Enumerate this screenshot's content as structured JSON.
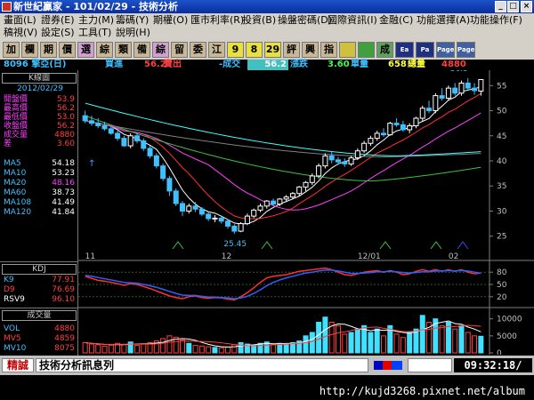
{
  "window": {
    "title": "新世紀贏家 - 101/02/29 - 技術分析"
  },
  "menu": {
    "row1": [
      "畫面(L)",
      "證券(E)",
      "主力(M)",
      "籌碼(Y)",
      "期權(O)",
      "匯市利率(R)",
      "投資(B)",
      "操盤密碼(D)",
      "國際資訊(I)",
      "金融(C)",
      "功能選擇(A)",
      "功能操作(F)"
    ],
    "row2": [
      "稿視(V)",
      "設定(S)",
      "工具(T)",
      "說明(H)"
    ]
  },
  "toolbar": {
    "buttons": [
      "加",
      "欄",
      "期",
      "價",
      "選",
      "綜",
      "類",
      "備",
      "綜",
      "留",
      "委",
      "江",
      "9",
      "8",
      "29",
      "評",
      "興",
      "指",
      "",
      "",
      "成",
      "Ea",
      "Pa",
      "Page",
      "Page"
    ]
  },
  "quote": {
    "symbol": "8096 擎亞(日)",
    "buy_label": "買進",
    "buy_value": "56.2",
    "sell_label": "賣出",
    "change_label": "-成交",
    "trade_value": "56.2",
    "rise_label": "漲跌",
    "change_value": "3.60",
    "volume_label": "單量",
    "total_qty": "658",
    "total_label": "總量",
    "total_value": "4880"
  },
  "info": {
    "box_title": "K線圖",
    "date": "2012/02/29",
    "rows": [
      {
        "label": "開盤價",
        "value": "53.9"
      },
      {
        "label": "最高價",
        "value": "56.2"
      },
      {
        "label": "最低價",
        "value": "53.0"
      },
      {
        "label": "收盤價",
        "value": "56.2"
      },
      {
        "label": "成交量",
        "value": "4880"
      },
      {
        "label": "差",
        "value": "3.60"
      }
    ],
    "ma": [
      {
        "label": "MA5",
        "value": "54.18"
      },
      {
        "label": "MA10",
        "value": "53.23"
      },
      {
        "label": "MA20",
        "value": "48.16"
      },
      {
        "label": "MA60",
        "value": "38.73"
      },
      {
        "label": "MA108",
        "value": "41.49"
      },
      {
        "label": "MA120",
        "value": "41.84"
      }
    ],
    "hi_marker": "56.5",
    "lo_marker": "25.45"
  },
  "kdj": {
    "title": "KDJ",
    "rows": [
      {
        "label": "K9",
        "value": "77.91"
      },
      {
        "label": "D9",
        "value": "76.69"
      },
      {
        "label": "RSV9",
        "value": "96.10"
      }
    ]
  },
  "volume": {
    "title": "成交量",
    "rows": [
      {
        "label": "VOL",
        "value": "4880"
      },
      {
        "label": "MV5",
        "value": "4859"
      },
      {
        "label": "MV10",
        "value": "8075"
      }
    ]
  },
  "status": {
    "left_label": "精誠",
    "message": "技術分析訊息列",
    "time": "09:32:18/"
  },
  "url": "http://kujd3268.pixnet.net/album",
  "colors": {
    "ma5": "#ffffff",
    "ma10": "#ff3030",
    "ma20": "#ff40ff",
    "ma60": "#40c040",
    "ma108": "#808080",
    "ma120": "#40ffff",
    "up": "#ff4040",
    "down": "#40c0ff",
    "k": "#ff3030",
    "d": "#3060ff"
  },
  "chart_data": [
    {
      "type": "candlestick",
      "title": "K線圖",
      "x_labels": [
        "11",
        "12",
        "12/01",
        "02"
      ],
      "ylim": [
        23,
        57
      ],
      "yticks": [
        25,
        30,
        35,
        40,
        45,
        50,
        55
      ],
      "price_hi": 56.5,
      "price_lo": 25.45,
      "ohlc": [
        [
          49.0,
          50.0,
          47.5,
          48.0
        ],
        [
          48.0,
          49.0,
          47.0,
          47.5
        ],
        [
          47.5,
          48.5,
          46.5,
          47.0
        ],
        [
          47.0,
          47.8,
          46.0,
          46.4
        ],
        [
          46.4,
          47.0,
          45.2,
          45.5
        ],
        [
          45.5,
          46.0,
          44.0,
          44.5
        ],
        [
          44.5,
          45.0,
          42.8,
          43.0
        ],
        [
          43.0,
          45.5,
          42.5,
          45.0
        ],
        [
          45.0,
          45.6,
          43.5,
          44.0
        ],
        [
          44.0,
          44.5,
          42.0,
          42.5
        ],
        [
          42.5,
          43.0,
          40.5,
          41.0
        ],
        [
          41.0,
          41.5,
          38.5,
          39.0
        ],
        [
          39.0,
          39.5,
          36.0,
          36.5
        ],
        [
          36.5,
          37.0,
          33.0,
          34.0
        ],
        [
          34.0,
          34.5,
          31.0,
          31.5
        ],
        [
          31.5,
          32.0,
          29.0,
          30.0
        ],
        [
          30.0,
          31.5,
          29.5,
          31.0
        ],
        [
          31.0,
          31.8,
          29.8,
          30.4
        ],
        [
          30.4,
          30.8,
          29.0,
          29.4
        ],
        [
          29.4,
          29.8,
          28.0,
          28.5
        ],
        [
          28.5,
          29.2,
          27.8,
          28.6
        ],
        [
          28.6,
          29.0,
          27.5,
          28.0
        ],
        [
          28.0,
          28.4,
          26.5,
          27.0
        ],
        [
          27.0,
          27.4,
          25.45,
          26.0
        ],
        [
          26.0,
          27.8,
          25.8,
          27.5
        ],
        [
          27.5,
          29.5,
          27.2,
          29.0
        ],
        [
          29.0,
          30.5,
          28.6,
          30.2
        ],
        [
          30.2,
          31.5,
          29.8,
          31.0
        ],
        [
          31.0,
          32.2,
          30.5,
          32.0
        ],
        [
          32.0,
          32.5,
          31.0,
          31.4
        ],
        [
          31.4,
          32.6,
          31.0,
          32.4
        ],
        [
          32.4,
          33.2,
          31.8,
          32.8
        ],
        [
          32.8,
          33.8,
          32.4,
          33.5
        ],
        [
          33.5,
          35.0,
          33.0,
          34.8
        ],
        [
          34.8,
          36.0,
          34.0,
          35.7
        ],
        [
          35.7,
          37.5,
          35.2,
          37.0
        ],
        [
          37.0,
          39.5,
          36.5,
          39.0
        ],
        [
          39.0,
          41.5,
          38.5,
          41.0
        ],
        [
          41.0,
          42.0,
          39.5,
          40.2
        ],
        [
          40.2,
          40.8,
          39.2,
          39.8
        ],
        [
          39.8,
          40.5,
          38.8,
          39.4
        ],
        [
          39.4,
          41.0,
          39.0,
          40.6
        ],
        [
          40.6,
          42.5,
          40.2,
          42.0
        ],
        [
          42.0,
          44.0,
          41.6,
          43.5
        ],
        [
          43.5,
          45.0,
          43.0,
          44.5
        ],
        [
          44.5,
          46.0,
          44.0,
          45.5
        ],
        [
          45.5,
          46.5,
          44.8,
          45.2
        ],
        [
          45.2,
          47.8,
          45.0,
          47.5
        ],
        [
          47.5,
          48.5,
          46.8,
          47.2
        ],
        [
          47.2,
          48.0,
          45.8,
          46.2
        ],
        [
          46.2,
          47.5,
          45.5,
          47.0
        ],
        [
          47.0,
          48.8,
          46.5,
          48.5
        ],
        [
          48.5,
          51.0,
          48.0,
          50.5
        ],
        [
          50.5,
          52.0,
          49.5,
          50.0
        ],
        [
          50.0,
          53.5,
          49.5,
          53.0
        ],
        [
          53.0,
          54.5,
          52.0,
          52.5
        ],
        [
          52.5,
          55.0,
          52.0,
          54.5
        ],
        [
          54.5,
          55.5,
          53.0,
          53.5
        ],
        [
          53.5,
          56.0,
          53.0,
          55.5
        ],
        [
          55.5,
          56.5,
          54.0,
          54.5
        ],
        [
          54.5,
          55.5,
          53.2,
          54.0
        ],
        [
          53.9,
          56.2,
          53.0,
          56.2
        ]
      ]
    },
    {
      "type": "line",
      "title": "KDJ",
      "ylim": [
        0,
        100
      ],
      "yticks": [
        20,
        50,
        80
      ],
      "series": [
        {
          "name": "K9",
          "values": [
            70,
            65,
            60,
            58,
            55,
            52,
            48,
            52,
            50,
            45,
            40,
            34,
            28,
            22,
            18,
            15,
            20,
            22,
            18,
            16,
            18,
            17,
            14,
            12,
            20,
            30,
            42,
            55,
            66,
            70,
            72,
            74,
            78,
            82,
            84,
            86,
            88,
            90,
            86,
            80,
            74,
            72,
            76,
            80,
            82,
            84,
            80,
            84,
            80,
            74,
            76,
            82,
            86,
            82,
            86,
            82,
            86,
            82,
            86,
            80,
            76,
            78
          ]
        },
        {
          "name": "D9",
          "values": [
            72,
            70,
            67,
            64,
            61,
            58,
            55,
            54,
            53,
            50,
            47,
            43,
            38,
            33,
            28,
            24,
            23,
            23,
            21,
            19,
            19,
            18,
            17,
            15,
            17,
            21,
            28,
            37,
            47,
            55,
            61,
            66,
            70,
            74,
            78,
            80,
            83,
            85,
            85,
            83,
            80,
            77,
            77,
            78,
            79,
            81,
            81,
            82,
            81,
            79,
            78,
            79,
            81,
            81,
            83,
            83,
            84,
            83,
            84,
            83,
            80,
            77
          ]
        }
      ]
    },
    {
      "type": "bar",
      "title": "成交量",
      "ylim": [
        0,
        12000
      ],
      "yticks": [
        0,
        5000,
        10000
      ],
      "values": [
        3000,
        2600,
        2400,
        2000,
        2300,
        2800,
        2500,
        3200,
        2200,
        2600,
        3000,
        3500,
        4200,
        5000,
        4600,
        3800,
        2800,
        2200,
        2000,
        1800,
        1600,
        1500,
        1700,
        2400,
        3000,
        2600,
        2200,
        2800,
        3200,
        2600,
        2800,
        2500,
        3000,
        3500,
        5000,
        6000,
        9000,
        10500,
        9000,
        8000,
        5500,
        6000,
        7000,
        8000,
        6000,
        7000,
        5000,
        8000,
        5500,
        4500,
        6000,
        7000,
        11000,
        9000,
        10000,
        8000,
        9000,
        7000,
        8000,
        6000,
        5000,
        4880
      ]
    }
  ]
}
